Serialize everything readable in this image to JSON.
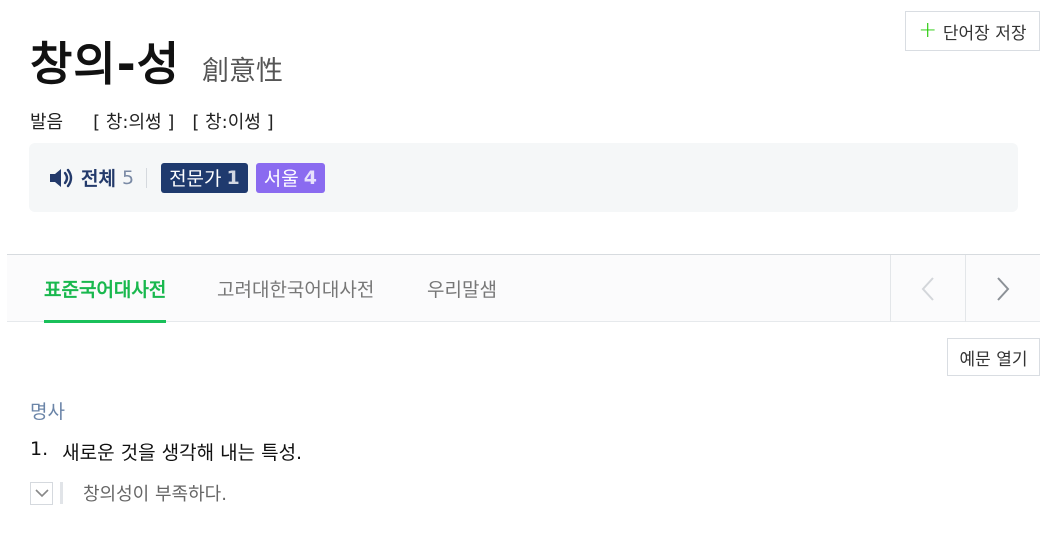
{
  "toolbar": {
    "save_label": "단어장 저장",
    "plus_glyph": "+"
  },
  "entry": {
    "word": "창의-성",
    "hanja": "創意性",
    "pronunciation": {
      "label": "발음",
      "variants": [
        "[ 창:의썽 ]",
        "[ 창:이썽 ]"
      ]
    }
  },
  "audio": {
    "icon": "speaker-icon",
    "all_label": "전체",
    "all_count": "5",
    "badges": [
      {
        "label": "전문가",
        "count": "1",
        "color": "#1f3a6e"
      },
      {
        "label": "서울",
        "count": "4",
        "color": "#8a6bf0"
      }
    ]
  },
  "tabs": {
    "items": [
      {
        "label": "표준국어대사전",
        "active": true
      },
      {
        "label": "고려대한국어대사전",
        "active": false
      },
      {
        "label": "우리말샘",
        "active": false
      }
    ],
    "prev_icon": "chevron-left-icon",
    "next_icon": "chevron-right-icon"
  },
  "content": {
    "example_toggle_label": "예문 열기",
    "part_of_speech": "명사",
    "definitions": [
      {
        "num": "1.",
        "text": "새로운 것을 생각해 내는 특성.",
        "example": "창의성이 부족하다."
      }
    ]
  },
  "colors": {
    "accent_green": "#19b84e",
    "pos_blue": "#6b85a8",
    "expert_badge": "#1f3a6e",
    "seoul_badge": "#8a6bf0"
  }
}
